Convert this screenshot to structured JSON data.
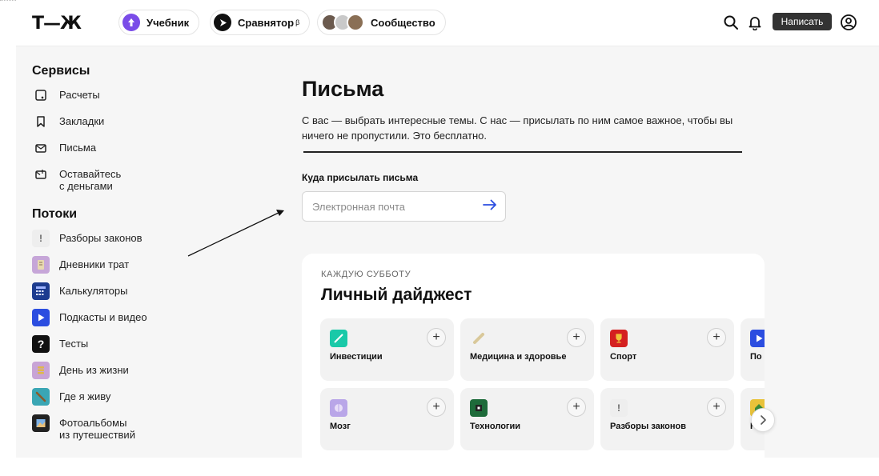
{
  "header": {
    "logo": "Т—Ж",
    "pills": [
      {
        "label": "Учебник",
        "icon": "up-arrow-icon",
        "color": "#7a4ce8"
      },
      {
        "label": "Сравнятор",
        "sup": "β",
        "icon": "play-triangle-icon",
        "color": "#111111"
      },
      {
        "label": "Сообщество",
        "icon": "avatar-group-icon"
      }
    ],
    "write_button": "Написать",
    "icons": [
      "search-icon",
      "bell-icon",
      "user-icon"
    ]
  },
  "sidebar": {
    "services_heading": "Сервисы",
    "services": [
      {
        "label": "Расчеты",
        "icon": "calculations-icon"
      },
      {
        "label": "Закладки",
        "icon": "bookmark-icon"
      },
      {
        "label": "Письма",
        "icon": "mail-icon"
      },
      {
        "label": "Оставайтесь\nс деньгами",
        "line1": "Оставайтесь",
        "line2": "с деньгами",
        "icon": "wallet-mail-icon"
      }
    ],
    "streams_heading": "Потоки",
    "streams": [
      {
        "label": "Разборы законов",
        "icon": "exclamation-icon",
        "color": "#eeeeee"
      },
      {
        "label": "Дневники трат",
        "icon": "diary-icon",
        "color": "#c6a6d8"
      },
      {
        "label": "Калькуляторы",
        "icon": "calculator-icon",
        "color": "#1d3c8f"
      },
      {
        "label": "Подкасты и видео",
        "icon": "play-icon",
        "color": "#2b4de0"
      },
      {
        "label": "Тесты",
        "icon": "question-icon",
        "color": "#111111"
      },
      {
        "label": "День из жизни",
        "icon": "coins-icon",
        "color": "#c8a4d6"
      },
      {
        "label": "Где я живу",
        "icon": "location-icon",
        "color": "#3aa6b4"
      },
      {
        "label": "Фотоальбомы из путешествий",
        "line1": "Фотоальбомы",
        "line2": "из путешествий",
        "icon": "photo-album-icon",
        "color": "#222222"
      }
    ]
  },
  "main": {
    "title": "Письма",
    "intro": "С вас — выбрать интересные темы. С нас — присылать по ним самое важное, чтобы вы ничего не пропустили. Это бесплатно.",
    "email_label": "Куда присылать письма",
    "email_placeholder": "Электронная почта"
  },
  "digest": {
    "frequency": "КАЖДУЮ СУББОТУ",
    "title": "Личный дайджест",
    "topics_row1": [
      {
        "name": "Инвестиции",
        "icon": "investments-icon",
        "color": "#19c9a8"
      },
      {
        "name": "Медицина и здоровье",
        "icon": "pill-icon",
        "color": "#d9c89a"
      },
      {
        "name": "Спорт",
        "icon": "trophy-icon",
        "color": "#d42020"
      },
      {
        "name": "По",
        "icon": "play-icon",
        "color": "#2b4de0"
      }
    ],
    "topics_row2": [
      {
        "name": "Мозг",
        "icon": "brain-icon",
        "color": "#b9a6e8"
      },
      {
        "name": "Технологии",
        "icon": "chip-icon",
        "color": "#1e6b3a"
      },
      {
        "name": "Разборы законов",
        "icon": "exclamation-icon",
        "color": "#eeeeee"
      },
      {
        "name": "Н",
        "icon": "house-icon",
        "color": "#e8c23a"
      }
    ]
  }
}
